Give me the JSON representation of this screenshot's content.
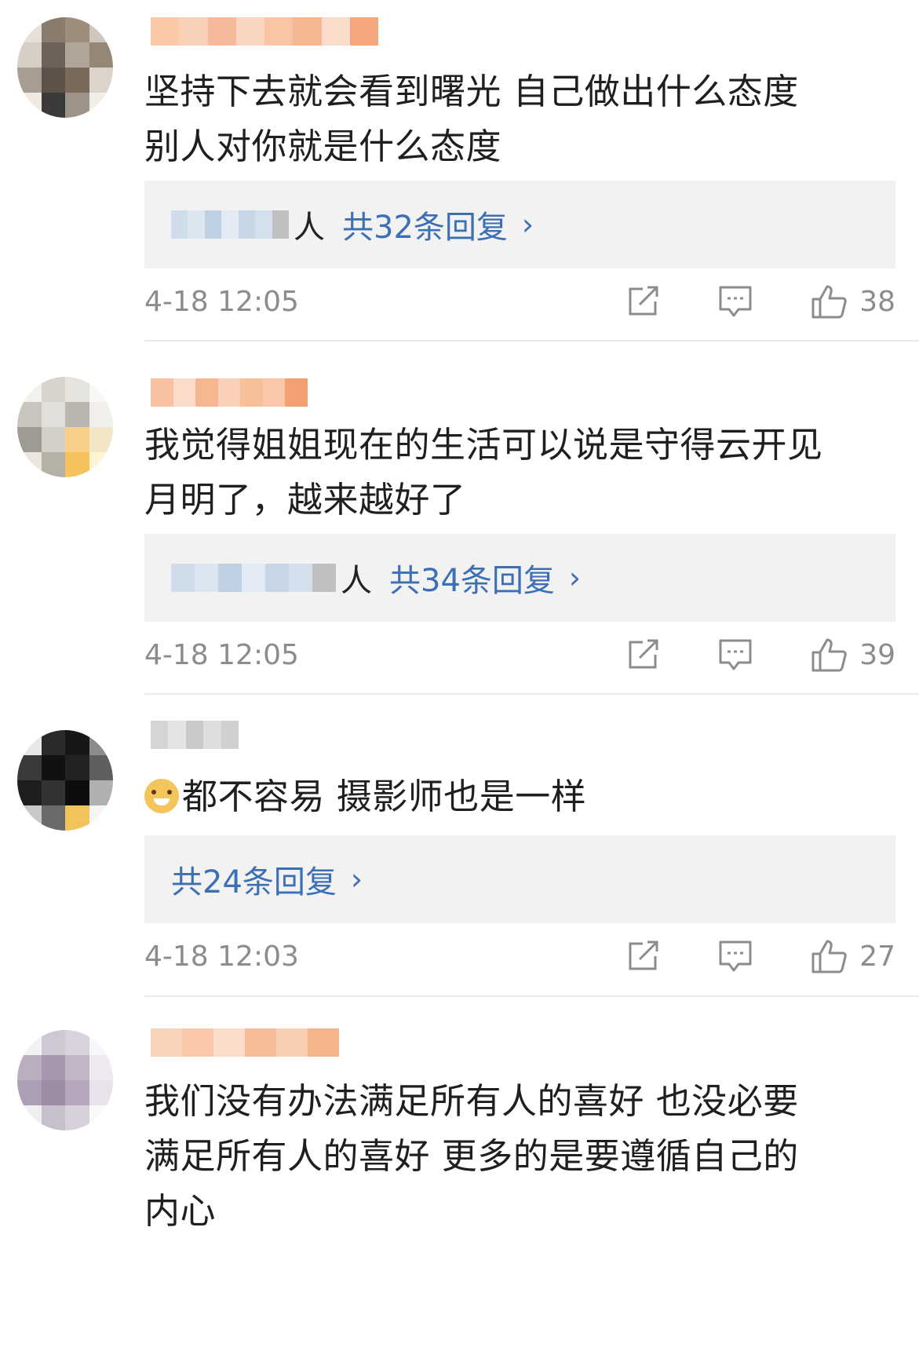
{
  "comments": [
    {
      "text_lines": [
        "坚持下去就会看到曙光 自己做出什么态度",
        "别人对你就是什么态度"
      ],
      "reply_people_suffix": "人",
      "reply_link": "共32条回复",
      "time": "4-18 12:05",
      "likes": "38",
      "avatar_colors": [
        "#e8e0d8",
        "#8a7c6c",
        "#9d8e7c",
        "#cfc7bd",
        "#d6cfc5",
        "#6d6258",
        "#b1a597",
        "#948776",
        "#a89d91",
        "#5d5248",
        "#7a6a5a",
        "#dcd4ca",
        "#efe9e1",
        "#3c3a38",
        "#9d9389",
        "#f1ede7"
      ],
      "name_colors": [
        "#f9c9a8",
        "#f7d2b9",
        "#f6b99a",
        "#fad6c0",
        "#f8c6a5",
        "#f5b890",
        "#fbdcc9",
        "#f4a77c"
      ]
    },
    {
      "text_lines": [
        "我觉得姐姐现在的生活可以说是守得云开见",
        "月明了，越来越好了"
      ],
      "reply_people_suffix": "人",
      "reply_link": "共34条回复",
      "time": "4-18 12:05",
      "likes": "39",
      "avatar_colors": [
        "#f2f1ee",
        "#d7d4cc",
        "#e4e3de",
        "#f7f7f5",
        "#c7c5bc",
        "#e1dfd9",
        "#b8b6ad",
        "#f0efeb",
        "#9e9b92",
        "#d1cfc8",
        "#f6d089",
        "#f2e6c7",
        "#ece7de",
        "#b5b1a6",
        "#f4c35b",
        "#fff3d6"
      ],
      "name_colors": [
        "#f8c2a1",
        "#fbdcca",
        "#f6b68f",
        "#fad0b7",
        "#f7bf9a",
        "#f9c8aa",
        "#f3a173"
      ]
    },
    {
      "text": "都不容易 摄影师也是一样",
      "reply_link": "共24条回复",
      "time": "4-18 12:03",
      "likes": "27",
      "avatar_colors": [
        "#e7e7e7",
        "#2a2a2a",
        "#171717",
        "#8c8c8c",
        "#3a3a3a",
        "#111111",
        "#222222",
        "#5f5f5f",
        "#1e1e1e",
        "#333333",
        "#0d0d0d",
        "#b0b0b0",
        "#c8c8c8",
        "#6a6a6a",
        "#f1c35c",
        "#f5f5f5"
      ],
      "name_colors": [
        "#d5d5d5",
        "#e4e4e4",
        "#c9c9c9",
        "#dedede",
        "#d0d0d0"
      ]
    },
    {
      "text_lines": [
        "我们没有办法满足所有人的喜好 也没必要",
        "满足所有人的喜好 更多的是要遵循自己的",
        "内心"
      ],
      "avatar_colors": [
        "#f3f1f4",
        "#cfc7d3",
        "#d9d1dd",
        "#f7f6f8",
        "#b9adbf",
        "#a797ad",
        "#c3b6c8",
        "#eeeaf0",
        "#ad9fb3",
        "#9d8ca4",
        "#b6a6bc",
        "#e8e2ea",
        "#f1eef2",
        "#c8bfcc",
        "#d7d0da",
        "#faf9fa"
      ],
      "name_colors": [
        "#fad3bb",
        "#f8c8a8",
        "#fbdcca",
        "#f6bc98",
        "#f9ceb1",
        "#f5b48a"
      ]
    }
  ],
  "reply_blur_colors": [
    "#cfdce9",
    "#dbe6f0",
    "#bfd0e2",
    "#e2ebf3",
    "#c6d6e6",
    "#d4e0ec",
    "#c0c0c0"
  ]
}
